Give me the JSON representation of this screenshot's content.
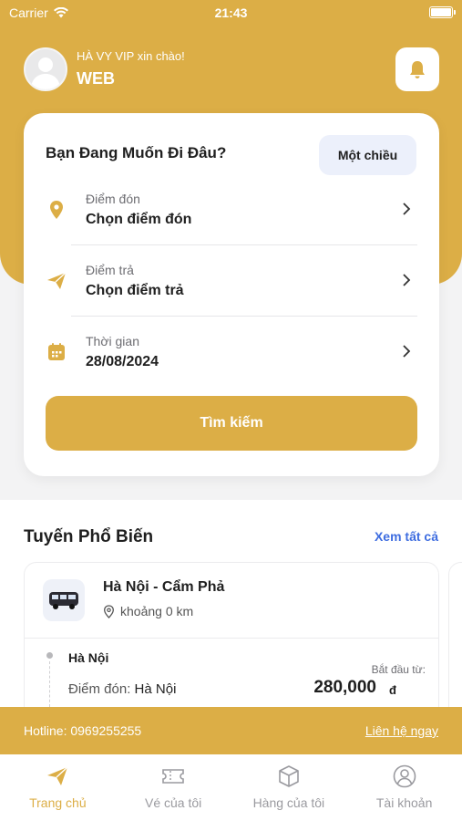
{
  "status_bar": {
    "carrier": "Carrier",
    "time": "21:43"
  },
  "header": {
    "greeting": "HÀ VY VIP xin chào!",
    "username": "WEB",
    "bell_icon": "bell-icon"
  },
  "search_card": {
    "title": "Bạn Đang Muốn Đi Đâu?",
    "trip_type": "Một chiều",
    "fields": [
      {
        "icon": "location-pin-icon",
        "label": "Điểm đón",
        "value": "Chọn điểm đón"
      },
      {
        "icon": "send-icon",
        "label": "Điểm trả",
        "value": "Chọn điểm trả"
      },
      {
        "icon": "calendar-icon",
        "label": "Thời gian",
        "value": "28/08/2024"
      }
    ],
    "search_button": "Tìm kiếm"
  },
  "popular": {
    "title": "Tuyến Phổ Biến",
    "see_all": "Xem tất cả",
    "routes": [
      {
        "name": "Hà Nội - Cẩm Phả",
        "distance": "khoảng 0 km",
        "stop_city": "Hà Nội",
        "pickup_label": "Điểm đón:",
        "pickup_value": "Hà Nội",
        "price_label": "Bắt đầu từ:",
        "price": "280,000",
        "price_unit": "đ"
      }
    ]
  },
  "hotline": {
    "text": "Hotline: 0969255255",
    "contact": "Liên hệ ngay"
  },
  "tabbar": [
    {
      "label": "Trang chủ",
      "icon": "send-icon",
      "active": true
    },
    {
      "label": "Vé của tôi",
      "icon": "ticket-icon",
      "active": false
    },
    {
      "label": "Hàng của tôi",
      "icon": "package-icon",
      "active": false
    },
    {
      "label": "Tài khoản",
      "icon": "user-icon",
      "active": false
    }
  ],
  "colors": {
    "accent": "#dcae46",
    "link": "#3e6de0",
    "chip_bg": "#ecf0fb"
  }
}
